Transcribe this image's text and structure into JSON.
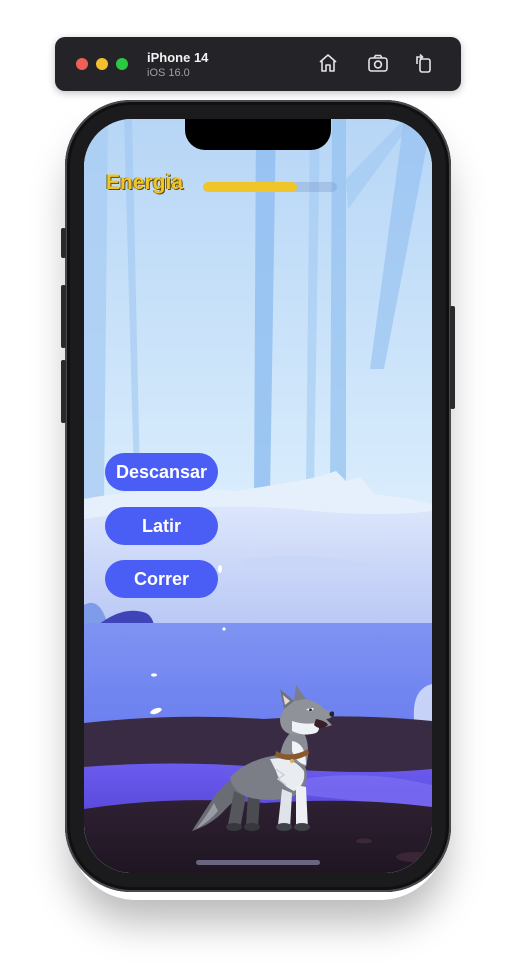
{
  "simulator": {
    "device_name": "iPhone 14",
    "os_version": "iOS 16.0",
    "icons": [
      "home-icon",
      "screenshot-icon",
      "rotate-icon"
    ]
  },
  "game": {
    "energy": {
      "label": "Energia",
      "level": 0.7
    },
    "buttons": {
      "rest": "Descansar",
      "bark": "Latir",
      "run": "Correr"
    },
    "character": "wolf",
    "colors": {
      "button": "#4a5ef6",
      "energy_bar": "#f0c52a",
      "energy_label": "#f0c52a"
    }
  }
}
